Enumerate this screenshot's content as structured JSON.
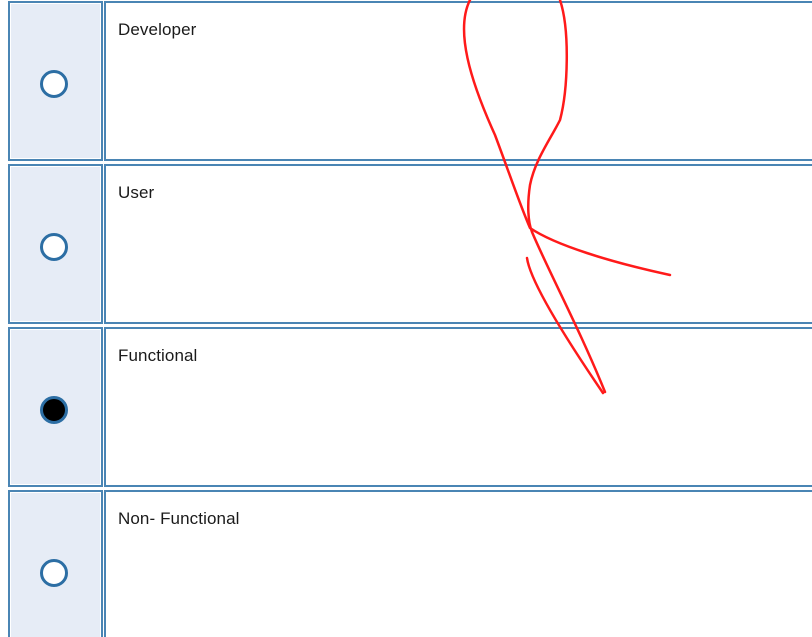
{
  "question": {
    "options": [
      {
        "label": "Developer",
        "selected": false
      },
      {
        "label": "User",
        "selected": false
      },
      {
        "label": "Functional",
        "selected": true
      },
      {
        "label": "Non- Functional",
        "selected": false
      }
    ]
  },
  "colors": {
    "border": "#4a85b4",
    "radio_cell_bg": "#e6ecf6",
    "radio_ring": "#2c6ea4",
    "annotation_stroke": "#ff0000"
  }
}
